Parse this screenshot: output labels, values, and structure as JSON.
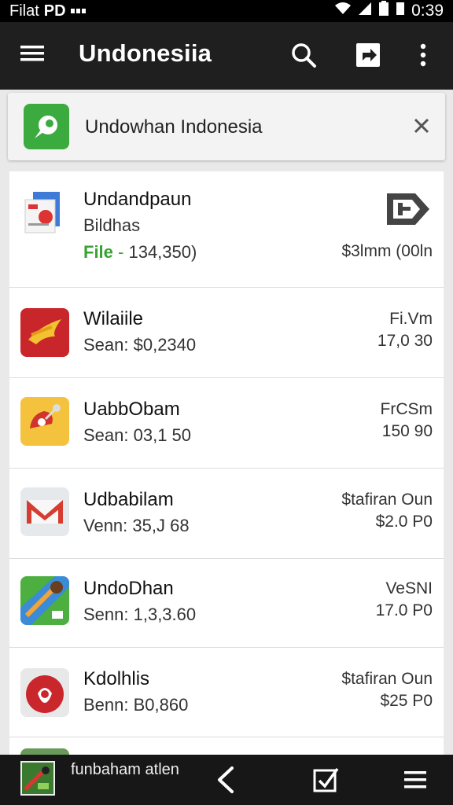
{
  "status_bar": {
    "left_text": "Filat",
    "left_badge": "PD",
    "time": "0:39"
  },
  "app_bar": {
    "title": "Undonesiia",
    "icons": [
      "menu-icon",
      "search-icon",
      "share-icon",
      "more-vert-icon"
    ]
  },
  "banner": {
    "text": "Undowhan Indonesia",
    "icon": "app-logo-icon",
    "close_icon": "close-icon"
  },
  "list": {
    "items": [
      {
        "name": "Undandpaun",
        "sub1": "Bildhas",
        "sub2_prefix": "File",
        "sub2_sep": " - ",
        "sub2_value": "134,350)",
        "right_line1": "",
        "right_line2": "$3lmm (00ln",
        "icon": "document-app-icon",
        "right_icon": "export-icon"
      },
      {
        "name": "Wilaiile",
        "sub1": "Sean: $0,2340",
        "right_line1": "Fi.Vm",
        "right_line2": "17,0 30",
        "icon": "bird-app-icon"
      },
      {
        "name": "UabbObam",
        "sub1": "Sean: 03,1 50",
        "right_line1": "FrCSm",
        "right_line2": "150 90",
        "icon": "location-app-icon"
      },
      {
        "name": "Udbabilam",
        "sub1": "Venn: 35,J 68",
        "right_line1": "$tafiran Oun",
        "right_line2": "$2.0 P0",
        "icon": "mail-app-icon"
      },
      {
        "name": "UndoDhan",
        "sub1": "Senn: 1,3,3.60",
        "right_line1": "VeSNI",
        "right_line2": "17.0 P0",
        "icon": "map-app-icon"
      },
      {
        "name": "Kdolhlis",
        "sub1": "Benn: B0,860",
        "right_line1": "$tafiran Oun",
        "right_line2": "$25 P0",
        "icon": "fruit-app-icon"
      }
    ]
  },
  "bottom_bar": {
    "label": "funbaham atlen",
    "icons": [
      "thumbnail-icon",
      "back-icon",
      "checkbox-icon",
      "hamburger-icon"
    ]
  },
  "colors": {
    "app_bar": "#1f1f1f",
    "file_green": "#3aa235",
    "bottom_bar": "#171717"
  }
}
